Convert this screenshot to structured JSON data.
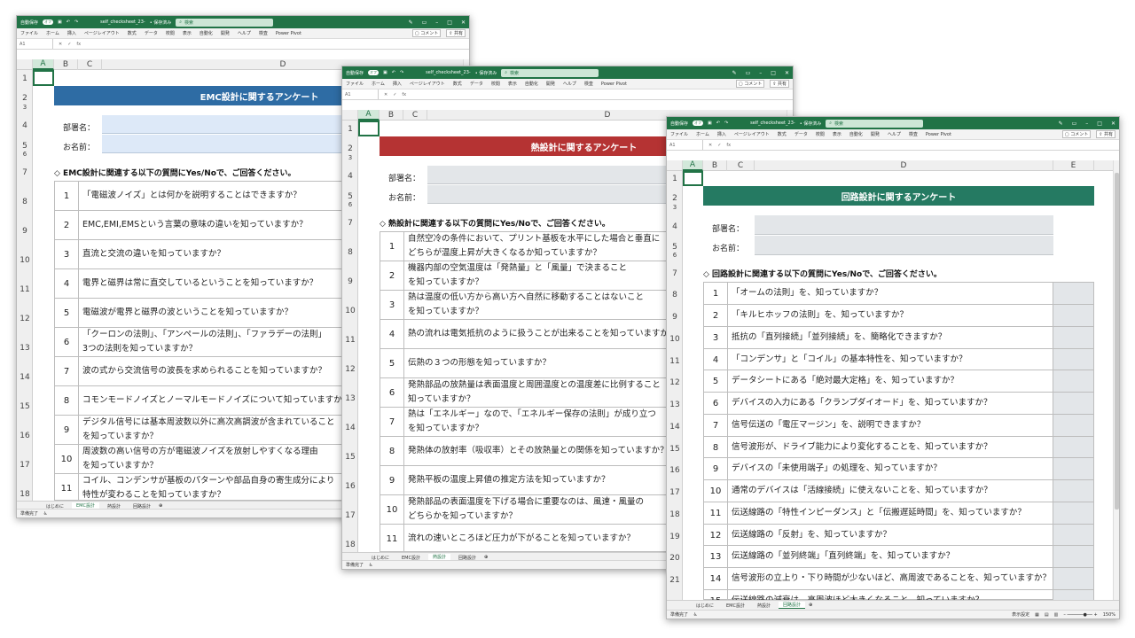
{
  "common": {
    "autosave_label": "自動保存",
    "autosave_state": "オフ",
    "file_name": "self_checksheet_23-",
    "save_state": "• 保存済み",
    "search_placeholder": "検索",
    "menus": [
      "ファイル",
      "ホーム",
      "挿入",
      "ページレイアウト",
      "数式",
      "データ",
      "校閲",
      "表示",
      "自動化",
      "開発",
      "ヘルプ",
      "検査",
      "Power Pivot"
    ],
    "comment_label": "コメント",
    "share_label": "共有",
    "name_box": "A1",
    "status_ready": "準備完了",
    "display_settings": "表示設定",
    "zoom": "150%",
    "tabs": [
      "はじめに",
      "EMC設計",
      "熱設計",
      "回路設計"
    ]
  },
  "emc": {
    "columns": [
      "A",
      "B",
      "C",
      "D"
    ],
    "title": "EMC設計に関するアンケート",
    "dept_label": "部署名：",
    "name_label": "お名前：",
    "instruction": "◇ EMC設計に関連する以下の質問にYes/Noで、ご回答ください。",
    "rows": [
      "1",
      "2",
      "3",
      "4",
      "5",
      "6",
      "7",
      "8",
      "9",
      "10",
      "11",
      "12",
      "13",
      "14",
      "15",
      "16",
      "17",
      "18"
    ],
    "questions": [
      {
        "n": "1",
        "t": "「電磁波ノイズ」とは何かを説明することはできますか？"
      },
      {
        "n": "2",
        "t": "EMC,EMI,EMSという言葉の意味の違いを知っていますか？"
      },
      {
        "n": "3",
        "t": "直流と交流の違いを知っていますか？"
      },
      {
        "n": "4",
        "t": "電界と磁界は常に直交しているということを知っていますか？"
      },
      {
        "n": "5",
        "t": "電磁波が電界と磁界の波ということを知っていますか？"
      },
      {
        "n": "6",
        "t": "「クーロンの法則」、「アンペールの法則」、「ファラデーの法則」\n3つの法則を知っていますか？"
      },
      {
        "n": "7",
        "t": "波の式から交流信号の波長を求められることを知っていますか？"
      },
      {
        "n": "8",
        "t": "コモンモードノイズとノーマルモードノイズについて知っていますか？"
      },
      {
        "n": "9",
        "t": "デジタル信号には基本周波数以外に高次高調波が含まれていること\nを知っていますか？"
      },
      {
        "n": "10",
        "t": "周波数の高い信号の方が電磁波ノイズを放射しやすくなる理由\nを知っていますか？"
      },
      {
        "n": "11",
        "t": "コイル、コンデンサが基板のパターンや部品自身の寄生成分により\n特性が変わることを知っていますか？"
      }
    ]
  },
  "thermal": {
    "columns": [
      "A",
      "B",
      "C",
      "D"
    ],
    "title": "熱設計に関するアンケート",
    "dept_label": "部署名：",
    "name_label": "お名前：",
    "instruction": "◇ 熱設計に関連する以下の質問にYes/Noで、ご回答ください。",
    "rows": [
      "1",
      "2",
      "3",
      "4",
      "5",
      "6",
      "7",
      "8",
      "9",
      "10",
      "11",
      "12",
      "13",
      "14",
      "15",
      "16",
      "17",
      "18"
    ],
    "questions": [
      {
        "n": "1",
        "t": "自然空冷の条件において、プリント基板を水平にした場合と垂直に\nどちらが温度上昇が大きくなるか知っていますか？"
      },
      {
        "n": "2",
        "t": "機器内部の空気温度は「発熱量」と「風量」で決まること\nを知っていますか？"
      },
      {
        "n": "3",
        "t": "熱は温度の低い方から高い方へ自然に移動することはないこと\nを知っていますか？"
      },
      {
        "n": "4",
        "t": "熱の流れは電気抵抗のように扱うことが出来ることを知っていますか？"
      },
      {
        "n": "5",
        "t": "伝熱の３つの形態を知っていますか？"
      },
      {
        "n": "6",
        "t": "発熱部品の放熱量は表面温度と周囲温度との温度差に比例すること\n知っていますか？"
      },
      {
        "n": "7",
        "t": "熱は「エネルギー」なので、「エネルギー保存の法則」が成り立つ\nを知っていますか？"
      },
      {
        "n": "8",
        "t": "発熱体の放射率（吸収率）とその放熱量との関係を知っていますか？"
      },
      {
        "n": "9",
        "t": "発熱平板の温度上昇値の推定方法を知っていますか？"
      },
      {
        "n": "10",
        "t": "発熱部品の表面温度を下げる場合に重要なのは、風速・風量の\nどちらかを知っていますか？"
      },
      {
        "n": "11",
        "t": "流れの速いところほど圧力が下がることを知っていますか？"
      }
    ]
  },
  "circuit": {
    "columns": [
      "A",
      "B",
      "C",
      "D",
      "E"
    ],
    "title": "回路設計に関するアンケート",
    "dept_label": "部署名：",
    "name_label": "お名前：",
    "instruction": "◇ 回路設計に関連する以下の質問にYes/Noで、ご回答ください。",
    "rows": [
      "1",
      "2",
      "3",
      "4",
      "5",
      "6",
      "7",
      "8",
      "9",
      "10",
      "11",
      "12",
      "13",
      "14",
      "15",
      "16",
      "17",
      "18",
      "19",
      "20",
      "21"
    ],
    "questions": [
      {
        "n": "1",
        "t": "「オームの法則」を、知っていますか？"
      },
      {
        "n": "2",
        "t": "「キルヒホッフの法則」を、知っていますか？"
      },
      {
        "n": "3",
        "t": "抵抗の「直列接続」「並列接続」を、簡略化できますか？"
      },
      {
        "n": "4",
        "t": "「コンデンサ」と「コイル」の基本特性を、知っていますか？"
      },
      {
        "n": "5",
        "t": "データシートにある「絶対最大定格」を、知っていますか？"
      },
      {
        "n": "6",
        "t": "デバイスの入力にある「クランプダイオード」を、知っていますか？"
      },
      {
        "n": "7",
        "t": "信号伝送の「電圧マージン」を、説明できますか？"
      },
      {
        "n": "8",
        "t": "信号波形が、ドライブ能力により変化することを、知っていますか？"
      },
      {
        "n": "9",
        "t": "デバイスの「未使用端子」の処理を、知っていますか？"
      },
      {
        "n": "10",
        "t": "通常のデバイスは「活線接続」に使えないことを、知っていますか？"
      },
      {
        "n": "11",
        "t": "伝送線路の「特性インピーダンス」と「伝搬遅延時間」を、知っていますか？"
      },
      {
        "n": "12",
        "t": "伝送線路の「反射」を、知っていますか？"
      },
      {
        "n": "13",
        "t": "伝送線路の「並列終端」「直列終端」を、知っていますか？"
      },
      {
        "n": "14",
        "t": "信号波形の立上り・下り時間が少ないほど、高周波であることを、知っていますか？"
      },
      {
        "n": "15",
        "t": "伝送線路の減衰は、高周波ほど大きくなること、知っていますか？"
      }
    ]
  },
  "colors": {
    "excel_green": "#217346",
    "emc_banner": "#2e6ca4",
    "thermal_banner": "#b53333",
    "circuit_banner": "#257a62",
    "emc_field": "#dde9f8",
    "gray_field": "#e3e6e9"
  }
}
